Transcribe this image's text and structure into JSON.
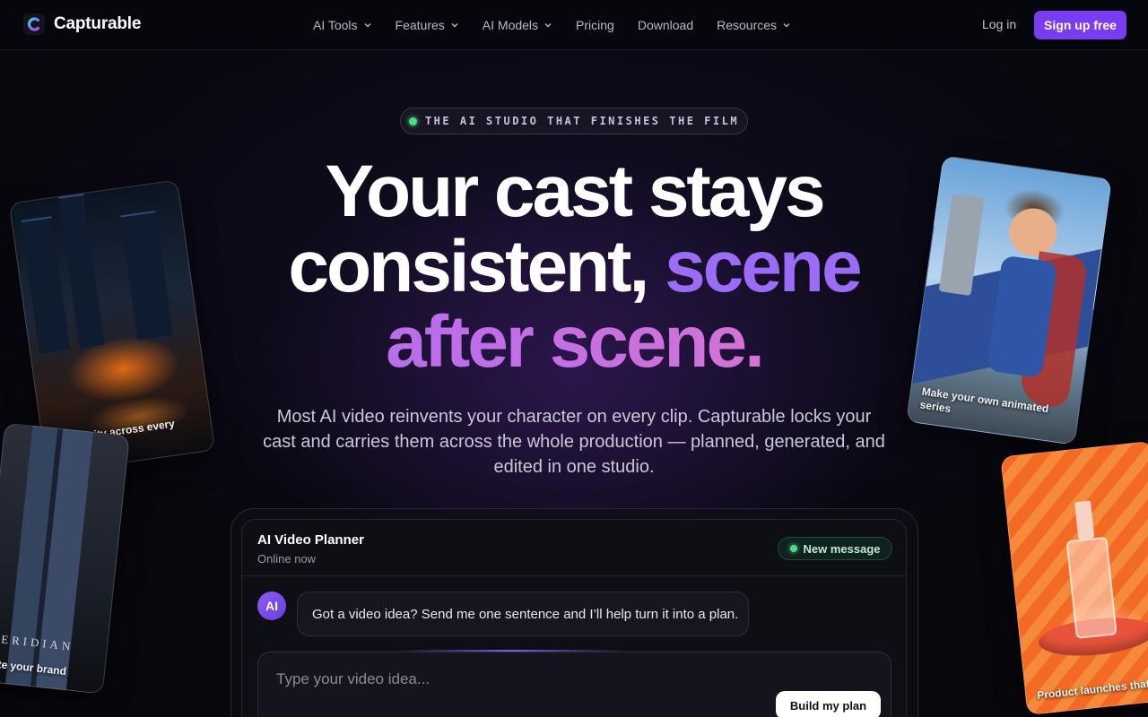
{
  "brand": {
    "name": "Capturable",
    "icon": "capturable-logo-icon"
  },
  "nav": {
    "items": [
      {
        "label": "AI Tools",
        "has_dropdown": true
      },
      {
        "label": "Features",
        "has_dropdown": true
      },
      {
        "label": "AI Models",
        "has_dropdown": true
      },
      {
        "label": "Pricing",
        "has_dropdown": false
      },
      {
        "label": "Download",
        "has_dropdown": false
      },
      {
        "label": "Resources",
        "has_dropdown": true
      }
    ],
    "login": "Log in",
    "signup": "Sign up free"
  },
  "hero": {
    "badge": "THE AI STUDIO THAT FINISHES THE FILM",
    "headline": {
      "line1": "Your cast stays",
      "line2_plain": "consistent,",
      "line2_accent": "scene",
      "line3": "after scene."
    },
    "subtitle": "Most AI video reinvents your character on every clip. Capturable locks your cast and carries them across the whole production — planned, generated, and edited in one studio."
  },
  "cards": {
    "city_car": "Continuity across every shot",
    "brand_jeans": "ote your brand",
    "brand_word": "ERIDIAN",
    "animated_series": "Make your own animated series",
    "product": "Product launches that s"
  },
  "chat": {
    "title": "AI Video Planner",
    "status": "Online now",
    "new_message": "New message",
    "avatar": "AI",
    "message": "Got a video idea? Send me one sentence and I’ll help turn it into a plan.",
    "input_placeholder": "Type your video idea...",
    "input_value": "",
    "build_button": "Build my plan"
  },
  "colors": {
    "background": "#07070d",
    "accent_purple": "#7a3cf0",
    "headline_gradient_start": "#a26cf2",
    "headline_gradient_end": "#f07bb6",
    "status_green": "#4ade80"
  }
}
